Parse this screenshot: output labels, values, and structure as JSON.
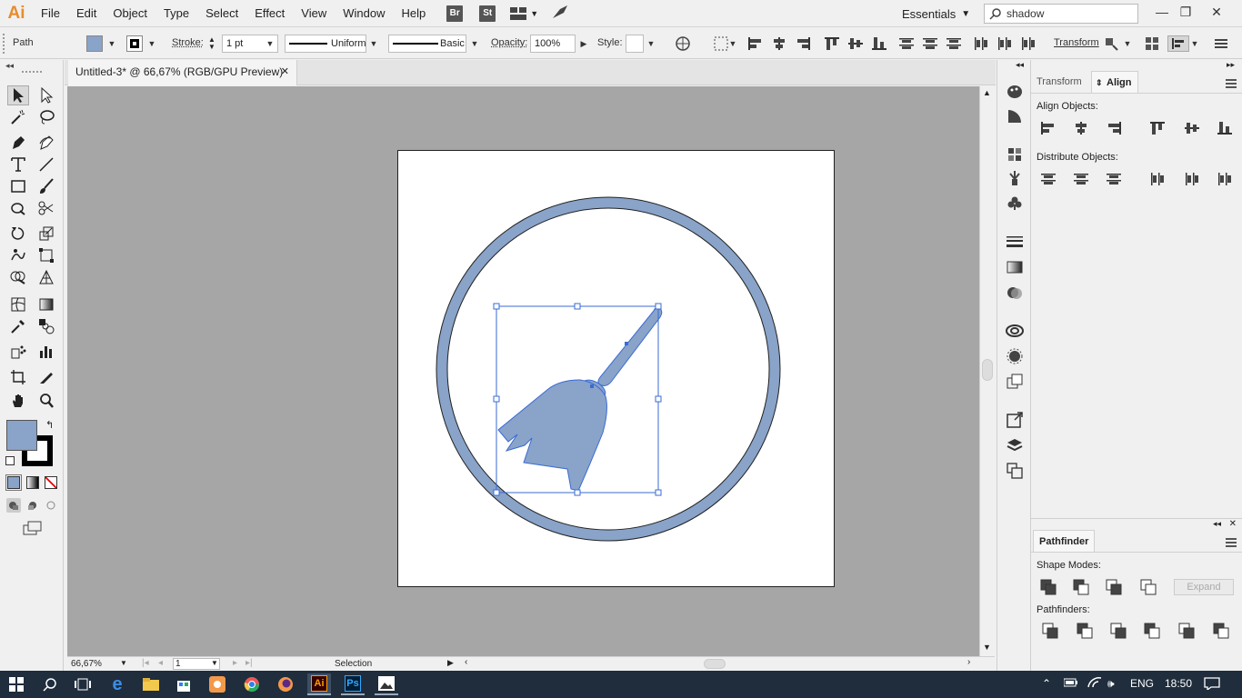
{
  "app": {
    "logo": "Ai"
  },
  "menu": [
    "File",
    "Edit",
    "Object",
    "Type",
    "Select",
    "Effect",
    "View",
    "Window",
    "Help"
  ],
  "bridge": {
    "br": "Br",
    "st": "St"
  },
  "workspace": {
    "label": "Essentials"
  },
  "search": {
    "value": "shadow"
  },
  "control": {
    "selection_type": "Path",
    "stroke_label": "Stroke:",
    "stroke_weight": "1 pt",
    "profile": "Uniform",
    "brush": "Basic",
    "opacity_label": "Opacity:",
    "opacity": "100%",
    "style_label": "Style:",
    "transform_label": "Transform"
  },
  "document": {
    "tab_title": "Untitled-3* @ 66,67% (RGB/GPU Preview)",
    "close": "✕"
  },
  "status": {
    "zoom": "66,67%",
    "artboard": "1",
    "tool": "Selection"
  },
  "panels": {
    "align": {
      "tab_transform": "Transform",
      "tab_align": "Align",
      "align_objects": "Align Objects:",
      "distribute_objects": "Distribute Objects:"
    },
    "pathfinder": {
      "tab": "Pathfinder",
      "shape_modes": "Shape Modes:",
      "pathfinders": "Pathfinders:",
      "expand": "Expand"
    }
  },
  "taskbar": {
    "lang": "ENG",
    "time": "18:50",
    "ai": "Ai",
    "ps": "Ps"
  },
  "colors": {
    "fill": "#89a3c9",
    "stroke": "#000000",
    "accent_select": "#3a6bd4"
  }
}
